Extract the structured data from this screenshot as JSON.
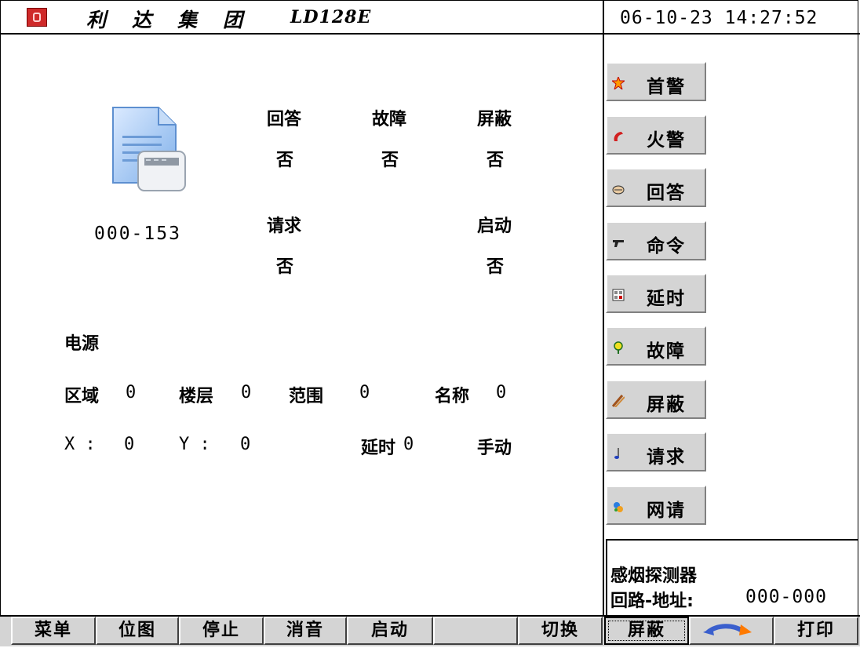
{
  "header": {
    "company_chars": [
      "利",
      "达",
      "集",
      "团"
    ],
    "model": "LD128E",
    "datetime": "06-10-23 14:27:52"
  },
  "device": {
    "code": "000-153",
    "icon": "document-panel-icon"
  },
  "status": [
    {
      "label": "回答",
      "value": "否"
    },
    {
      "label": "故障",
      "value": "否"
    },
    {
      "label": "屏蔽",
      "value": "否"
    },
    {
      "label": "请求",
      "value": "否"
    },
    {
      "label": "启动",
      "value": "否"
    }
  ],
  "details": {
    "power_label": "电源",
    "zone_label": "区域",
    "zone_value": "0",
    "floor_label": "楼层",
    "floor_value": "0",
    "range_label": "范围",
    "range_value": "0",
    "name_label": "名称",
    "name_value": "0",
    "x_label": "X :",
    "x_value": "0",
    "y_label": "Y :",
    "y_value": "0",
    "delay_label": "延时",
    "delay_value": "0",
    "mode": "手动"
  },
  "side_buttons": [
    {
      "label": "首警",
      "icon": "first-alarm-icon"
    },
    {
      "label": "火警",
      "icon": "fire-alarm-icon"
    },
    {
      "label": "回答",
      "icon": "answer-icon"
    },
    {
      "label": "命令",
      "icon": "command-icon"
    },
    {
      "label": "延时",
      "icon": "delay-icon"
    },
    {
      "label": "故障",
      "icon": "fault-icon"
    },
    {
      "label": "屏蔽",
      "icon": "shield-icon"
    },
    {
      "label": "请求",
      "icon": "request-icon"
    },
    {
      "label": "网请",
      "icon": "network-request-icon"
    }
  ],
  "info": {
    "device_type": "感烟探测器",
    "loop_address_label": "回路-地址:",
    "loop_address_value": "000-000"
  },
  "bottom_buttons": [
    {
      "label": "菜单"
    },
    {
      "label": "位图"
    },
    {
      "label": "停止"
    },
    {
      "label": "消音"
    },
    {
      "label": "启动"
    },
    {
      "label": ""
    },
    {
      "label": "切换"
    },
    {
      "label": "屏蔽"
    },
    {
      "label": "",
      "icon": "rotate-arrows-icon"
    },
    {
      "label": "打印"
    }
  ],
  "colors": {
    "button_face": "#d4d4d4",
    "logo_red": "#cf2a2a",
    "arrow_blue": "#3a5fcd",
    "arrow_orange": "#ff7a00"
  }
}
